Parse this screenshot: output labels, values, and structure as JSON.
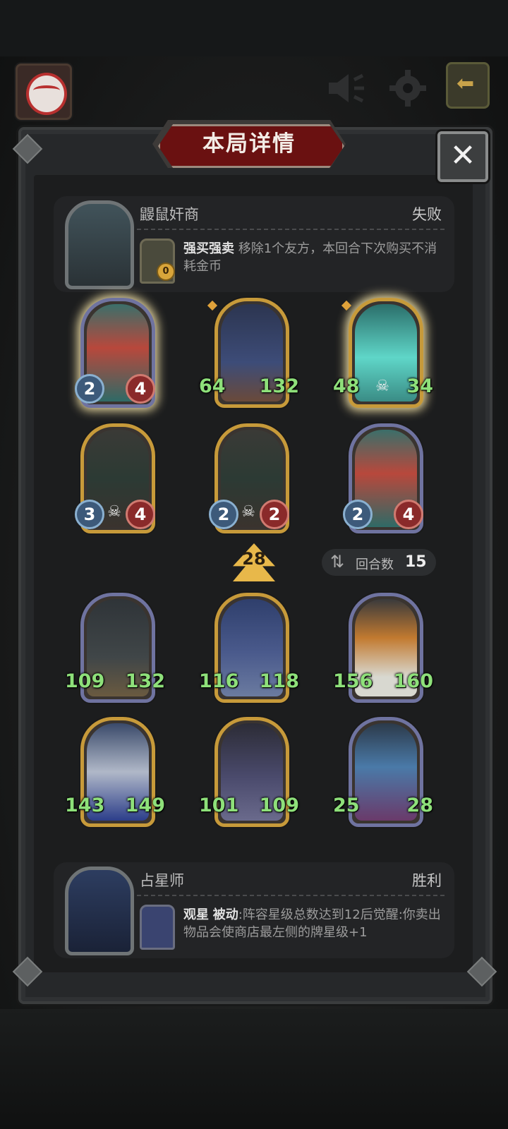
{
  "header": {
    "title": "本局详情",
    "close_icon": "✕"
  },
  "opponent": {
    "name": "鼹鼠奸商",
    "result": "失败",
    "coin": "0",
    "skill_name": "强买强卖",
    "skill_desc": "移除1个友方，本回合下次购买不消耗金币"
  },
  "opponent_units": [
    {
      "atk": "2",
      "hp": "4",
      "frame": "silver",
      "glow": true,
      "art": "redhead"
    },
    {
      "atk": "64",
      "hp": "132",
      "frame": "gold",
      "art": "wizard"
    },
    {
      "atk": "48",
      "hp": "34",
      "frame": "gold",
      "glow": true,
      "skull": true,
      "art": "ghost"
    },
    {
      "atk": "3",
      "hp": "4",
      "frame": "gold",
      "skull": true,
      "art": "chest"
    },
    {
      "atk": "2",
      "hp": "2",
      "frame": "gold",
      "skull": true,
      "art": "chest"
    },
    {
      "atk": "2",
      "hp": "4",
      "frame": "silver",
      "art": "redhead"
    }
  ],
  "middle": {
    "level": "28",
    "rounds_label": "回合数",
    "rounds_value": "15"
  },
  "player_units": [
    {
      "atk": "109",
      "hp": "132",
      "frame": "silver",
      "art": "boy"
    },
    {
      "atk": "116",
      "hp": "118",
      "frame": "gold",
      "art": "witch"
    },
    {
      "atk": "156",
      "hp": "160",
      "frame": "silver",
      "art": "pumpkin"
    },
    {
      "atk": "143",
      "hp": "149",
      "frame": "gold",
      "art": "knight"
    },
    {
      "atk": "101",
      "hp": "109",
      "frame": "gold",
      "art": "octo"
    },
    {
      "atk": "25",
      "hp": "28",
      "frame": "silver",
      "art": "elf"
    }
  ],
  "player": {
    "name": "占星师",
    "result": "胜利",
    "skill_name": "观星",
    "skill_tag": "被动",
    "skill_desc": ":阵容星级总数达到12后觉醒:你卖出物品会使商店最左侧的牌星级+1"
  }
}
